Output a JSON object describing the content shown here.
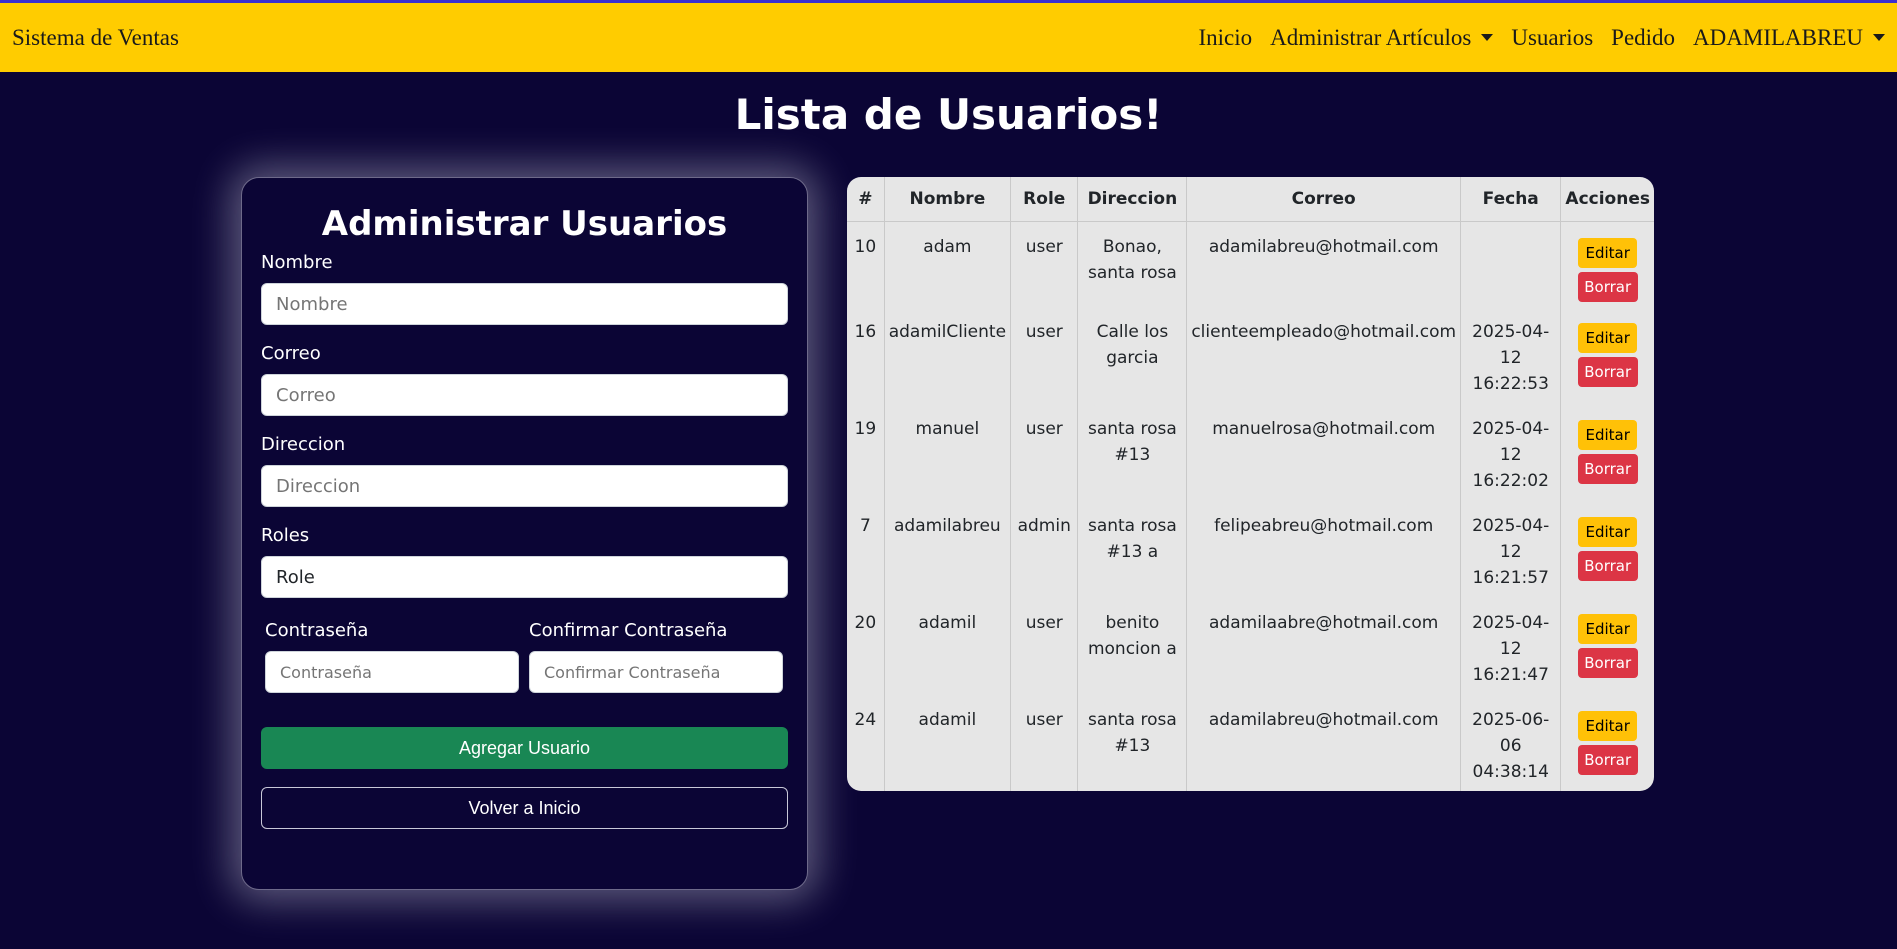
{
  "navbar": {
    "brand": "Sistema de Ventas",
    "links": {
      "inicio": "Inicio",
      "articulos": "Administrar Artículos",
      "usuarios": "Usuarios",
      "pedido": "Pedido",
      "user": "ADAMILABREU"
    }
  },
  "page": {
    "title": "Lista de Usuarios!"
  },
  "form": {
    "title": "Administrar Usuarios",
    "nombre_label": "Nombre",
    "nombre_placeholder": "Nombre",
    "correo_label": "Correo",
    "correo_placeholder": "Correo",
    "direccion_label": "Direccion",
    "direccion_placeholder": "Direccion",
    "roles_label": "Roles",
    "roles_value": "Role",
    "password_label": "Contraseña",
    "password_placeholder": "Contraseña",
    "confirm_label": "Confirmar Contraseña",
    "confirm_placeholder": "Confirmar Contraseña",
    "add_button": "Agregar Usuario",
    "back_button": "Volver a Inicio"
  },
  "table": {
    "headers": [
      "#",
      "Nombre",
      "Role",
      "Direccion",
      "Correo",
      "Fecha",
      "Acciones"
    ],
    "edit_label": "Editar",
    "delete_label": "Borrar",
    "rows": [
      {
        "id": "10",
        "nombre": "adam",
        "role": "user",
        "dir1": "Bonao,",
        "dir2": "santa rosa",
        "correo": "adamilabreu@hotmail.com",
        "f1": "",
        "f2": "",
        "f3": ""
      },
      {
        "id": "16",
        "nombre": "adamilCliente",
        "role": "user",
        "dir1": "Calle los",
        "dir2": "garcia",
        "correo": "clienteempleado@hotmail.com",
        "f1": "2025-04-",
        "f2": "12",
        "f3": "16:22:53"
      },
      {
        "id": "19",
        "nombre": "manuel",
        "role": "user",
        "dir1": "santa rosa",
        "dir2": "#13",
        "correo": "manuelrosa@hotmail.com",
        "f1": "2025-04-",
        "f2": "12",
        "f3": "16:22:02"
      },
      {
        "id": "7",
        "nombre": "adamilabreu",
        "role": "admin",
        "dir1": "santa rosa",
        "dir2": "#13 a",
        "correo": "felipeabreu@hotmail.com",
        "f1": "2025-04-",
        "f2": "12",
        "f3": "16:21:57"
      },
      {
        "id": "20",
        "nombre": "adamil",
        "role": "user",
        "dir1": "benito",
        "dir2": "moncion a",
        "correo": "adamilaabre@hotmail.com",
        "f1": "2025-04-",
        "f2": "12",
        "f3": "16:21:47"
      },
      {
        "id": "24",
        "nombre": "adamil",
        "role": "user",
        "dir1": "santa rosa",
        "dir2": "#13",
        "correo": "adamilabreu@hotmail.com",
        "f1": "2025-06-",
        "f2": "06",
        "f3": "04:38:14"
      }
    ]
  }
}
